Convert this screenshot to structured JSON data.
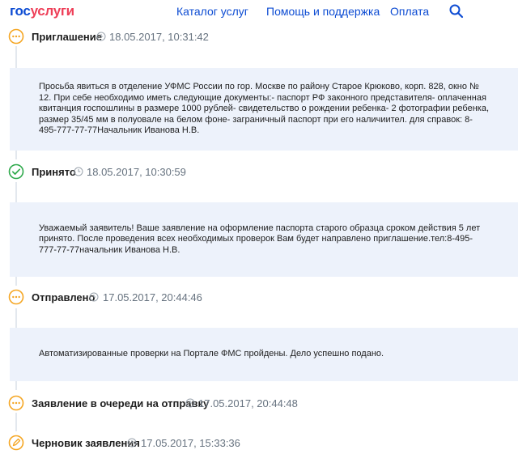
{
  "header": {
    "logo_part1": "гос",
    "logo_part2": "услуги",
    "nav": [
      "Каталог услуг",
      "Помощь и поддержка",
      "Оплата"
    ]
  },
  "events": [
    {
      "status": "Приглашение",
      "timestamp": "18.05.2017, 10:31:42",
      "icon": "pending-circle-icon",
      "message": "Просьба явиться в отделение УФМС России по гор. Москве по району Старое Крюково, корп. 828, окно № 12. При себе необходимо иметь следующие документы:- паспорт РФ законного представителя- оплаченная квитанция госпошлины в размере 1000 рублей- свидетельство о рождении ребенка- 2 фотографии ребенка, размер 35/45 мм в полуовале на белом фоне- заграничный паспорт при его наличиител. для справок: 8-495-777-77-77Начальник Иванова Н.В."
    },
    {
      "status": "Принято",
      "timestamp": "18.05.2017, 10:30:59",
      "icon": "check-circle-icon",
      "message": "Уважаемый заявитель! Ваше заявление на оформление паспорта старого образца сроком действия 5 лет принято. После проведения всех необходимых проверок Вам будет направлено приглашение.тел:8-495-777-77-77начальник Иванова Н.В."
    },
    {
      "status": "Отправлено",
      "timestamp": "17.05.2017, 20:44:46",
      "icon": "pending-circle-icon",
      "message": "Автоматизированные проверки на Портале ФМС пройдены. Дело успешно подано."
    },
    {
      "status": "Заявление в очереди на отправку",
      "timestamp": "17.05.2017, 20:44:48",
      "icon": "pending-circle-icon",
      "message": ""
    },
    {
      "status": "Черновик заявления",
      "timestamp": "17.05.2017, 15:33:36",
      "icon": "draft-circle-icon",
      "message": ""
    }
  ],
  "colors": {
    "brand_blue": "#0d4cd3",
    "brand_red": "#ee3f58",
    "pending_orange": "#f5a623",
    "success_green": "#2ea94b",
    "message_bg": "#edf2fb",
    "muted_text": "#66727f"
  }
}
